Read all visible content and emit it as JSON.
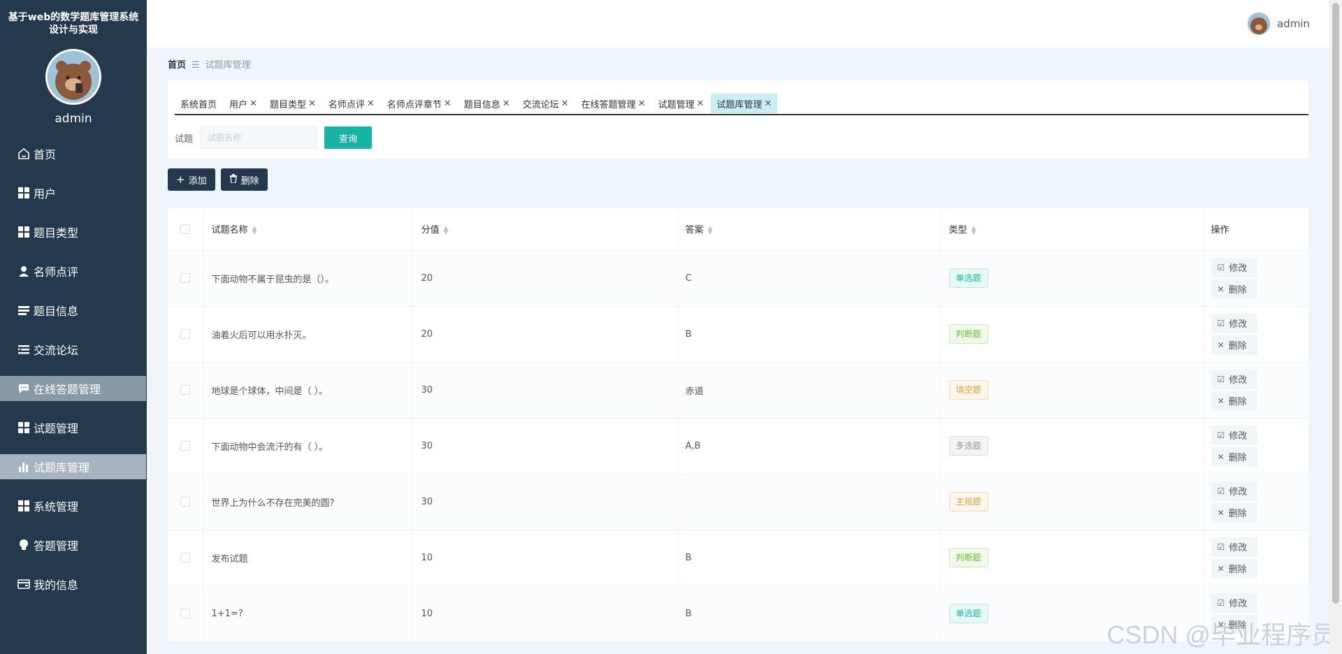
{
  "sidebar": {
    "system_title": "基于web的数学题库管理系统设计与实现",
    "user_name": "admin",
    "items": [
      {
        "label": "首页",
        "icon": "home-icon"
      },
      {
        "label": "用户",
        "icon": "grid-icon"
      },
      {
        "label": "题目类型",
        "icon": "grid-icon"
      },
      {
        "label": "名师点评",
        "icon": "person-icon"
      },
      {
        "label": "题目信息",
        "icon": "list-icon"
      },
      {
        "label": "交流论坛",
        "icon": "list-indent-icon"
      },
      {
        "label": "在线答题管理",
        "icon": "chat-icon"
      },
      {
        "label": "试题管理",
        "icon": "grid-icon"
      },
      {
        "label": "试题库管理",
        "icon": "bar-chart-icon"
      },
      {
        "label": "系统管理",
        "icon": "grid-icon"
      },
      {
        "label": "答题管理",
        "icon": "bulb-icon"
      },
      {
        "label": "我的信息",
        "icon": "wallet-icon"
      }
    ]
  },
  "header": {
    "user_name": "admin"
  },
  "breadcrumb": {
    "home": "首页",
    "separator": "☰",
    "current": "试题库管理"
  },
  "tabs": [
    {
      "label": "系统首页",
      "closable": false
    },
    {
      "label": "用户",
      "closable": true
    },
    {
      "label": "题目类型",
      "closable": true
    },
    {
      "label": "名师点评",
      "closable": true
    },
    {
      "label": "名师点评章节",
      "closable": true
    },
    {
      "label": "题目信息",
      "closable": true
    },
    {
      "label": "交流论坛",
      "closable": true
    },
    {
      "label": "在线答题管理",
      "closable": true
    },
    {
      "label": "试题管理",
      "closable": true
    },
    {
      "label": "试题库管理",
      "closable": true
    }
  ],
  "search": {
    "label": "试题",
    "placeholder": "试题名称",
    "value": "",
    "button": "查询"
  },
  "actions": {
    "add": "添加",
    "delete": "删除"
  },
  "table": {
    "columns": {
      "name": "试题名称",
      "score": "分值",
      "answer": "答案",
      "type": "类型",
      "op": "操作"
    },
    "rows": [
      {
        "name": "下面动物不属于昆虫的是（）。",
        "score": "20",
        "answer": "C",
        "type": "单选题"
      },
      {
        "name": "油着火后可以用水扑灭。",
        "score": "20",
        "answer": "B",
        "type": "判断题"
      },
      {
        "name": "地球是个球体，中间是（ ）。",
        "score": "30",
        "answer": "赤道",
        "type": "填空题"
      },
      {
        "name": "下面动物中会流汗的有（ ）。",
        "score": "30",
        "answer": "A,B",
        "type": "多选题"
      },
      {
        "name": "世界上为什么不存在完美的圆?",
        "score": "30",
        "answer": "",
        "type": "主观题"
      },
      {
        "name": "发布试题",
        "score": "10",
        "answer": "B",
        "type": "判断题"
      },
      {
        "name": "1+1=?",
        "score": "10",
        "answer": "B",
        "type": "单选题"
      }
    ],
    "edit_label": "修改",
    "delete_label": "删除"
  },
  "type_colors": {
    "单选题": {
      "fg": "#13c2a3",
      "bg": "#e8f8f5",
      "border": "#b7ebe1"
    },
    "判断题": {
      "fg": "#67c23a",
      "bg": "#f0f9eb",
      "border": "#c9e9b6"
    },
    "填空题": {
      "fg": "#e6a23c",
      "bg": "#fdf6ec",
      "border": "#f5dab1"
    },
    "多选题": {
      "fg": "#909399",
      "bg": "#f4f4f5",
      "border": "#dcdde0"
    },
    "主观题": {
      "fg": "#e6a23c",
      "bg": "#fdf6ec",
      "border": "#f5dab1"
    }
  },
  "watermark": "CSDN @毕业程序员"
}
